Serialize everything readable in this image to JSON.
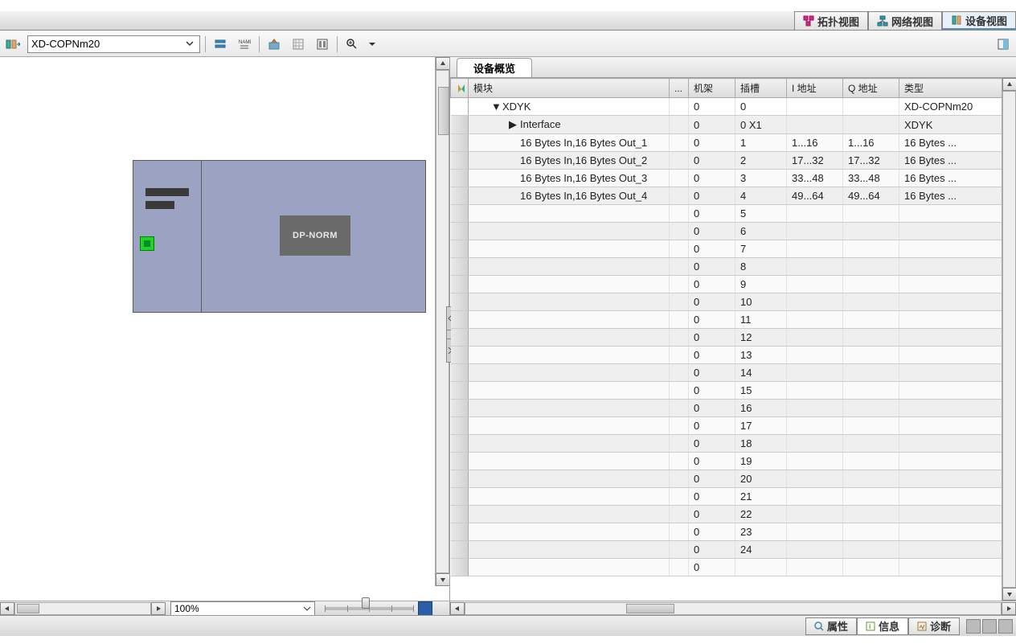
{
  "top_tabs": {
    "topology": "拓扑视图",
    "network": "网络视图",
    "device": "设备视图"
  },
  "toolbar": {
    "device_dropdown": "XD-COPNm20"
  },
  "canvas": {
    "device_label": "DP-NORM",
    "zoom_value": "100%"
  },
  "right_panel": {
    "tab_title": "设备概览",
    "columns": {
      "module": "模块",
      "dots": "...",
      "rack": "机架",
      "slot": "插槽",
      "i_addr": "I 地址",
      "q_addr": "Q 地址",
      "type": "类型"
    },
    "rows": [
      {
        "indent": 0,
        "toggle": "▼",
        "module": "XDYK",
        "rack": "0",
        "slot": "0",
        "i": "",
        "q": "",
        "type": "XD-COPNm20",
        "selected": true
      },
      {
        "indent": 1,
        "toggle": "▶",
        "module": "Interface",
        "rack": "0",
        "slot": "0 X1",
        "i": "",
        "q": "",
        "type": "XDYK"
      },
      {
        "indent": 2,
        "toggle": "",
        "module": "16 Bytes In,16 Bytes Out_1",
        "rack": "0",
        "slot": "1",
        "i": "1...16",
        "q": "1...16",
        "type": "16 Bytes ..."
      },
      {
        "indent": 2,
        "toggle": "",
        "module": "16 Bytes In,16 Bytes Out_2",
        "rack": "0",
        "slot": "2",
        "i": "17...32",
        "q": "17...32",
        "type": "16 Bytes ..."
      },
      {
        "indent": 2,
        "toggle": "",
        "module": "16 Bytes In,16 Bytes Out_3",
        "rack": "0",
        "slot": "3",
        "i": "33...48",
        "q": "33...48",
        "type": "16 Bytes ..."
      },
      {
        "indent": 2,
        "toggle": "",
        "module": "16 Bytes In,16 Bytes Out_4",
        "rack": "0",
        "slot": "4",
        "i": "49...64",
        "q": "49...64",
        "type": "16 Bytes ..."
      },
      {
        "indent": 2,
        "toggle": "",
        "module": "",
        "rack": "0",
        "slot": "5",
        "i": "",
        "q": "",
        "type": ""
      },
      {
        "indent": 2,
        "toggle": "",
        "module": "",
        "rack": "0",
        "slot": "6",
        "i": "",
        "q": "",
        "type": ""
      },
      {
        "indent": 2,
        "toggle": "",
        "module": "",
        "rack": "0",
        "slot": "7",
        "i": "",
        "q": "",
        "type": ""
      },
      {
        "indent": 2,
        "toggle": "",
        "module": "",
        "rack": "0",
        "slot": "8",
        "i": "",
        "q": "",
        "type": ""
      },
      {
        "indent": 2,
        "toggle": "",
        "module": "",
        "rack": "0",
        "slot": "9",
        "i": "",
        "q": "",
        "type": ""
      },
      {
        "indent": 2,
        "toggle": "",
        "module": "",
        "rack": "0",
        "slot": "10",
        "i": "",
        "q": "",
        "type": ""
      },
      {
        "indent": 2,
        "toggle": "",
        "module": "",
        "rack": "0",
        "slot": "11",
        "i": "",
        "q": "",
        "type": ""
      },
      {
        "indent": 2,
        "toggle": "",
        "module": "",
        "rack": "0",
        "slot": "12",
        "i": "",
        "q": "",
        "type": ""
      },
      {
        "indent": 2,
        "toggle": "",
        "module": "",
        "rack": "0",
        "slot": "13",
        "i": "",
        "q": "",
        "type": ""
      },
      {
        "indent": 2,
        "toggle": "",
        "module": "",
        "rack": "0",
        "slot": "14",
        "i": "",
        "q": "",
        "type": ""
      },
      {
        "indent": 2,
        "toggle": "",
        "module": "",
        "rack": "0",
        "slot": "15",
        "i": "",
        "q": "",
        "type": ""
      },
      {
        "indent": 2,
        "toggle": "",
        "module": "",
        "rack": "0",
        "slot": "16",
        "i": "",
        "q": "",
        "type": ""
      },
      {
        "indent": 2,
        "toggle": "",
        "module": "",
        "rack": "0",
        "slot": "17",
        "i": "",
        "q": "",
        "type": ""
      },
      {
        "indent": 2,
        "toggle": "",
        "module": "",
        "rack": "0",
        "slot": "18",
        "i": "",
        "q": "",
        "type": ""
      },
      {
        "indent": 2,
        "toggle": "",
        "module": "",
        "rack": "0",
        "slot": "19",
        "i": "",
        "q": "",
        "type": ""
      },
      {
        "indent": 2,
        "toggle": "",
        "module": "",
        "rack": "0",
        "slot": "20",
        "i": "",
        "q": "",
        "type": ""
      },
      {
        "indent": 2,
        "toggle": "",
        "module": "",
        "rack": "0",
        "slot": "21",
        "i": "",
        "q": "",
        "type": ""
      },
      {
        "indent": 2,
        "toggle": "",
        "module": "",
        "rack": "0",
        "slot": "22",
        "i": "",
        "q": "",
        "type": ""
      },
      {
        "indent": 2,
        "toggle": "",
        "module": "",
        "rack": "0",
        "slot": "23",
        "i": "",
        "q": "",
        "type": ""
      },
      {
        "indent": 2,
        "toggle": "",
        "module": "",
        "rack": "0",
        "slot": "24",
        "i": "",
        "q": "",
        "type": ""
      },
      {
        "indent": 2,
        "toggle": "",
        "module": "",
        "rack": "0",
        "slot": "",
        "i": "",
        "q": "",
        "type": ""
      }
    ]
  },
  "bottom_tabs": {
    "properties": "属性",
    "info": "信息",
    "diagnostics": "诊断"
  }
}
